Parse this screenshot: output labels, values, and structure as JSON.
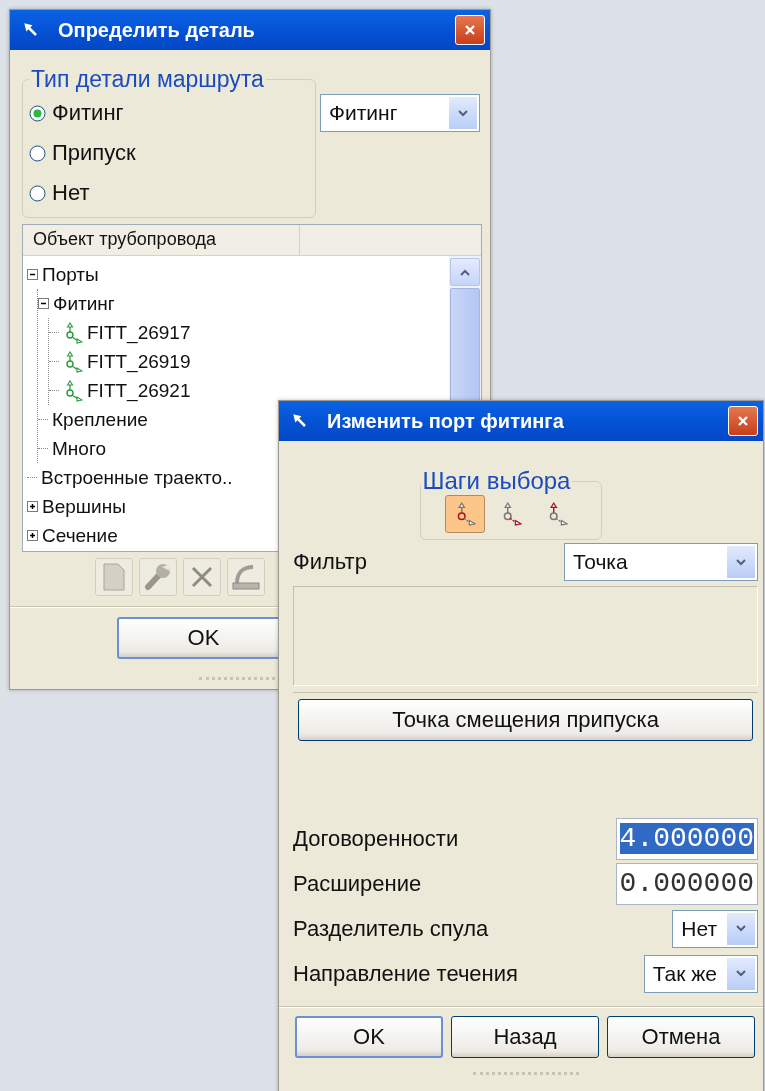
{
  "define_part_window": {
    "title": "Определить деталь",
    "route_part_type": {
      "legend": "Тип детали маршрута",
      "options": [
        {
          "label": "Фитинг",
          "selected": true
        },
        {
          "label": "Припуск",
          "selected": false
        },
        {
          "label": "Нет",
          "selected": false
        }
      ]
    },
    "type_dropdown": {
      "value": "Фитинг"
    },
    "tree": {
      "column_header": "Объект трубопровода",
      "items": [
        {
          "label": "Порты",
          "expanded": true,
          "children": [
            {
              "label": "Фитинг",
              "expanded": true,
              "children": [
                {
                  "label": "FITT_26917",
                  "kind": "port"
                },
                {
                  "label": "FITT_26919",
                  "kind": "port"
                },
                {
                  "label": "FITT_26921",
                  "kind": "port"
                }
              ]
            },
            {
              "label": "Крепление"
            },
            {
              "label": "Много"
            }
          ]
        },
        {
          "label": "Встроенные траекто.."
        },
        {
          "label": "Вершины",
          "expanded": false
        },
        {
          "label": "Сечение",
          "expanded": false
        }
      ]
    },
    "toolbar": [
      {
        "kind": "page"
      },
      {
        "kind": "wrench"
      },
      {
        "kind": "cross"
      },
      {
        "kind": "pipe"
      }
    ],
    "buttons": [
      {
        "label": "OK"
      }
    ]
  },
  "edit_port_window": {
    "title": "Изменить порт фитинга",
    "selection_steps": {
      "legend": "Шаги выбора",
      "steps": [
        {
          "kind": "origin",
          "selected": true
        },
        {
          "kind": "direction",
          "selected": false
        },
        {
          "kind": "up",
          "selected": false
        }
      ]
    },
    "filter": {
      "label": "Фильтр",
      "value": "Точка"
    },
    "offset_button": "Точка смещения припуска",
    "fields": [
      {
        "kind": "number",
        "label": "Договоренности",
        "value": "4.000000",
        "text_selected": true
      },
      {
        "kind": "number",
        "label": "Расширение",
        "value": "0.000000",
        "text_selected": false
      },
      {
        "kind": "dropdown",
        "label": "Разделитель спула",
        "value": "Нет"
      },
      {
        "kind": "dropdown",
        "label": "Направление течения",
        "value": "Так же"
      }
    ],
    "buttons": [
      {
        "label": "OK",
        "default": true
      },
      {
        "label": "Назад",
        "default": false
      },
      {
        "label": "Отмена",
        "default": false
      }
    ]
  }
}
